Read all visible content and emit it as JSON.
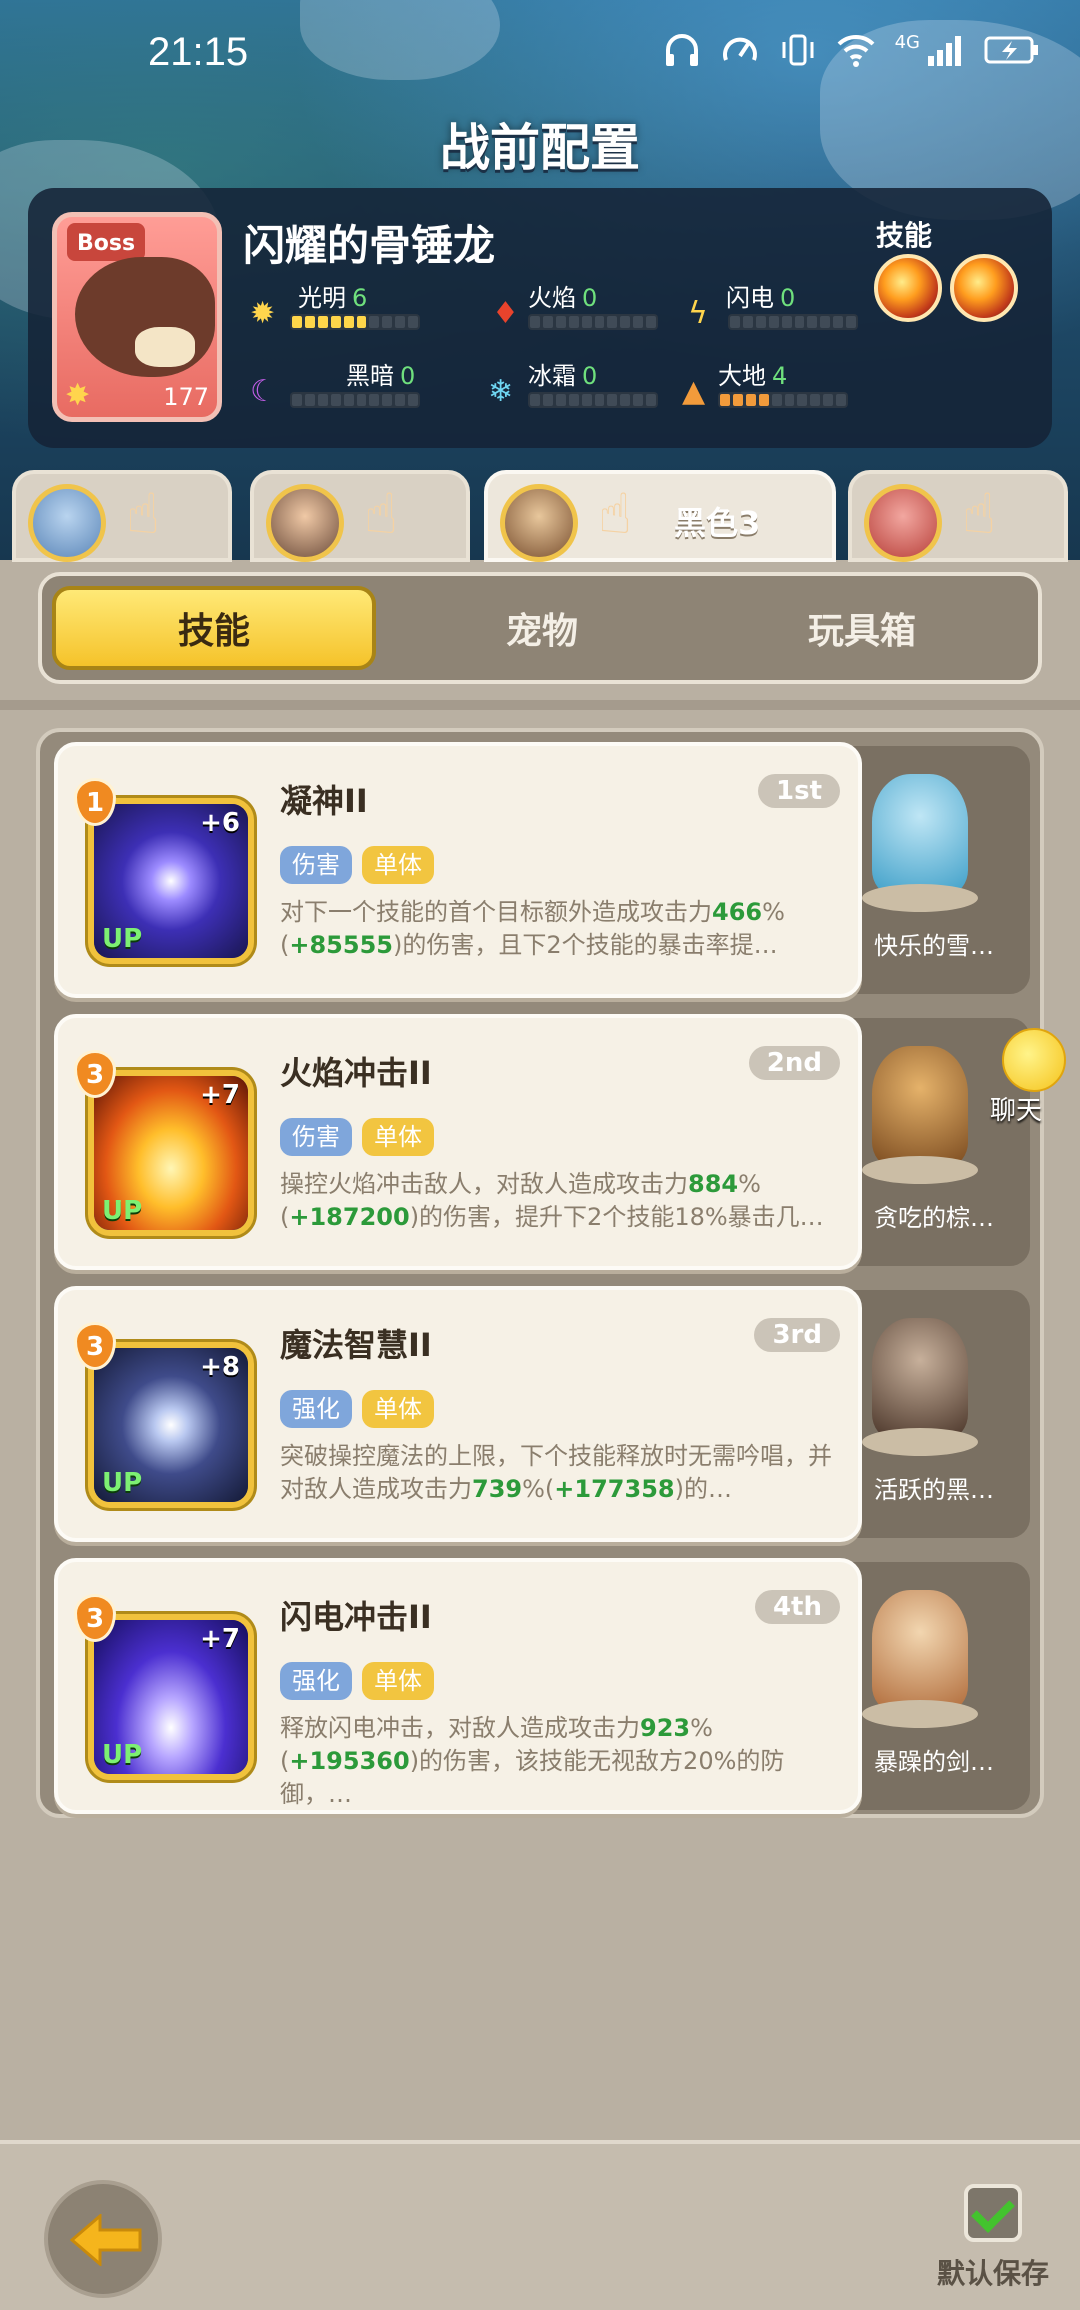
{
  "status_bar": {
    "time": "21:15",
    "network": "4G"
  },
  "header": {
    "title": "战前配置"
  },
  "boss": {
    "tag": "Boss",
    "level": "177",
    "name": "闪耀的骨锤龙",
    "skills_label": "技能",
    "elements": [
      {
        "label": "光明",
        "value": "6"
      },
      {
        "label": "火焰",
        "value": "0"
      },
      {
        "label": "闪电",
        "value": "0"
      },
      {
        "label": "黑暗",
        "value": "0"
      },
      {
        "label": "冰霜",
        "value": "0"
      },
      {
        "label": "大地",
        "value": "4"
      }
    ]
  },
  "hero_tabs": [
    {
      "label": ""
    },
    {
      "label": ""
    },
    {
      "label": "黑色3"
    },
    {
      "label": ""
    }
  ],
  "main_tabs": {
    "skills": "技能",
    "pets": "宠物",
    "toybox": "玩具箱"
  },
  "skills": [
    {
      "level": "1",
      "plus": "+6",
      "up": "UP",
      "name": "凝神II",
      "rank": "1st",
      "tag1": "伤害",
      "tag2": "单体",
      "desc_a": "对下一个技能的首个目标额外造成攻击力",
      "desc_g1": "466",
      "desc_b": "%(",
      "desc_g2": "+85555",
      "desc_c": ")的伤害，且下2个技能的暴击率提…",
      "pet": "快乐的雪…"
    },
    {
      "level": "3",
      "plus": "+7",
      "up": "UP",
      "name": "火焰冲击II",
      "rank": "2nd",
      "tag1": "伤害",
      "tag2": "单体",
      "desc_a": "操控火焰冲击敌人，对敌人造成攻击力",
      "desc_g1": "884",
      "desc_b": "%(",
      "desc_g2": "+187200",
      "desc_c": ")的伤害，提升下2个技能18%暴击几…",
      "pet": "贪吃的棕…"
    },
    {
      "level": "3",
      "plus": "+8",
      "up": "UP",
      "name": "魔法智慧II",
      "rank": "3rd",
      "tag1": "强化",
      "tag2": "单体",
      "desc_a": "突破操控魔法的上限，下个技能释放时无需吟唱，并对敌人造成攻击力",
      "desc_g1": "739",
      "desc_b": "%(",
      "desc_g2": "+177358",
      "desc_c": ")的…",
      "pet": "活跃的黑…"
    },
    {
      "level": "3",
      "plus": "+7",
      "up": "UP",
      "name": "闪电冲击II",
      "rank": "4th",
      "tag1": "强化",
      "tag2": "单体",
      "desc_a": "释放闪电冲击，对敌人造成攻击力",
      "desc_g1": "923",
      "desc_b": "%(",
      "desc_g2": "+195360",
      "desc_c": ")的伤害，该技能无视敌方20%的防御，…",
      "pet": "暴躁的剑…"
    }
  ],
  "chat": {
    "label": "聊天"
  },
  "footer": {
    "save_label": "默认保存"
  }
}
